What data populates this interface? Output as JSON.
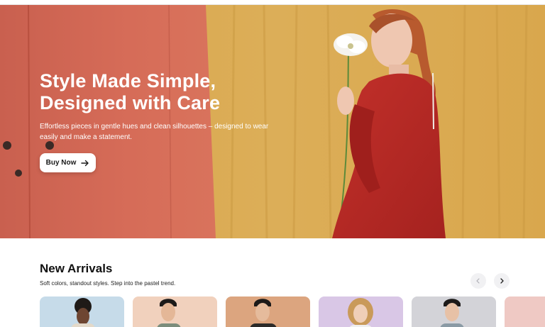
{
  "hero": {
    "title_line1": "Style Made Simple,",
    "title_line2": "Designed with Care",
    "subtitle": "Effortless pieces in gentle hues and clean silhouettes – designed to wear easily and make a statement.",
    "cta_label": "Buy Now",
    "cta_icon": "arrow-right-icon"
  },
  "arrivals": {
    "title": "New Arrivals",
    "subtitle": "Soft colors, standout styles. Step into the pastel trend.",
    "prev_icon": "chevron-left-icon",
    "next_icon": "chevron-right-icon"
  },
  "products": [
    {
      "bg": "#c6dbe9"
    },
    {
      "bg": "#f1d1bd"
    },
    {
      "bg": "#dca57f"
    },
    {
      "bg": "#d9c7e6"
    },
    {
      "bg": "#d3d3d8"
    },
    {
      "bg": "#efc9c4"
    }
  ],
  "colors": {
    "hero_coral": "#d06a57",
    "hero_mustard": "#d9a64c",
    "dress_red": "#b42a25"
  }
}
